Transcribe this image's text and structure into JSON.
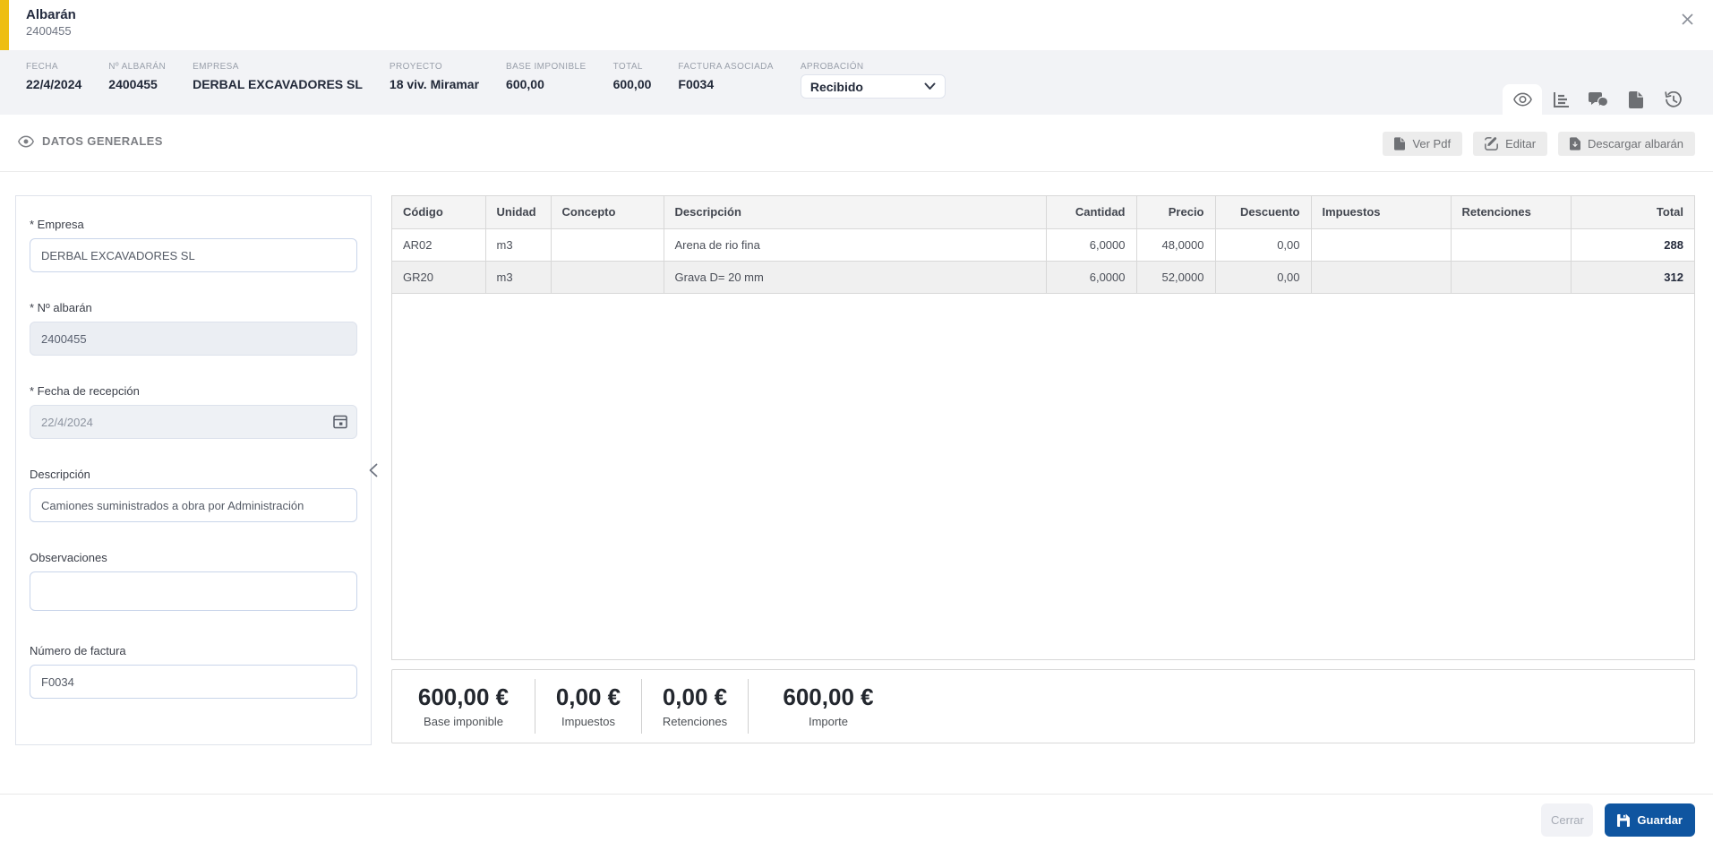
{
  "header": {
    "title": "Albarán",
    "subtitle": "2400455",
    "accent_color": "#eebe12"
  },
  "infobar": {
    "fields": [
      {
        "label": "FECHA",
        "value": "22/4/2024"
      },
      {
        "label": "Nº ALBARÁN",
        "value": "2400455"
      },
      {
        "label": "EMPRESA",
        "value": "DERBAL EXCAVADORES SL"
      },
      {
        "label": "PROYECTO",
        "value": "18 viv. Miramar"
      },
      {
        "label": "BASE IMPONIBLE",
        "value": "600,00"
      },
      {
        "label": "TOTAL",
        "value": "600,00"
      },
      {
        "label": "FACTURA ASOCIADA",
        "value": "F0034"
      }
    ],
    "aprobacion": {
      "label": "APROBACIÓN",
      "value": "Recibido"
    }
  },
  "tabs": {
    "icons": [
      "eye-icon",
      "bar-chart-icon",
      "comments-icon",
      "document-icon",
      "history-icon"
    ],
    "active": "eye-icon"
  },
  "toolbar": {
    "section_title": "DATOS GENERALES",
    "buttons": [
      {
        "label": "Ver Pdf",
        "icon": "file-icon"
      },
      {
        "label": "Editar",
        "icon": "edit-icon"
      },
      {
        "label": "Descargar albarán",
        "icon": "download-file-icon"
      }
    ]
  },
  "form": {
    "fields": [
      {
        "label": "* Empresa",
        "value": "DERBAL EXCAVADORES SL"
      },
      {
        "label": "* Nº albarán",
        "value": "2400455"
      },
      {
        "label": "* Fecha de recepción",
        "value": "22/4/2024"
      },
      {
        "label": "Descripción",
        "value": "Camiones suministrados a obra por Administración"
      },
      {
        "label": "Observaciones",
        "value": ""
      },
      {
        "label": "Número de factura",
        "value": "F0034"
      }
    ]
  },
  "table": {
    "columns": [
      "Código",
      "Unidad",
      "Concepto",
      "Descripción",
      "Cantidad",
      "Precio",
      "Descuento",
      "Impuestos",
      "Retenciones",
      "Total"
    ],
    "rows": [
      [
        "AR02",
        "m3",
        "",
        "Arena de rio fina",
        "6,0000",
        "48,0000",
        "0,00",
        "",
        "",
        "288"
      ],
      [
        "GR20",
        "m3",
        "",
        "Grava D= 20 mm",
        "6,0000",
        "52,0000",
        "0,00",
        "",
        "",
        "312"
      ]
    ]
  },
  "totals": [
    {
      "value": "600,00 €",
      "label": "Base imponible"
    },
    {
      "value": "0,00 €",
      "label": "Impuestos"
    },
    {
      "value": "0,00 €",
      "label": "Retenciones"
    },
    {
      "value": "600,00 €",
      "label": "Importe"
    }
  ],
  "footer": {
    "close_label": "Cerrar",
    "save_label": "Guardar"
  },
  "colors": {
    "accent_yellow": "#eebe12",
    "primary_blue": "#0f55a0",
    "band_bg": "#f2f3f6",
    "row_alt": "#f0f0f0"
  }
}
